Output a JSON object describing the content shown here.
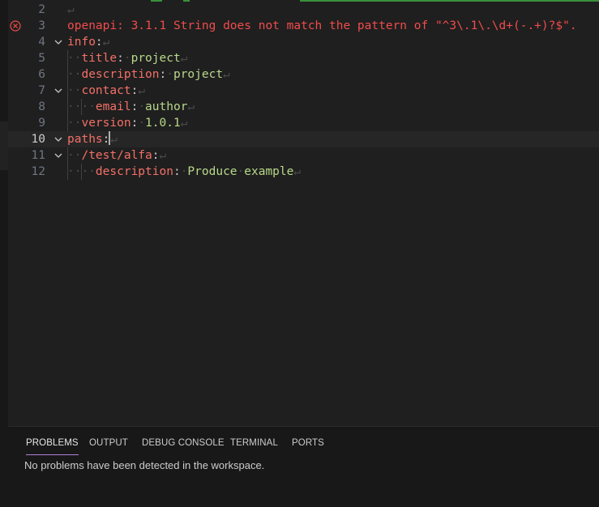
{
  "editor": {
    "lines": [
      {
        "number": "2",
        "segments": []
      },
      {
        "number": "3",
        "error": true,
        "segments": [
          {
            "t": "openapi",
            "c": "err"
          },
          {
            "t": ":",
            "c": "err"
          },
          {
            "t": " ",
            "c": "err"
          },
          {
            "t": "3.1.1 String does not match the pattern of \"^3\\.1\\.\\d+(-.+)?$\".",
            "c": "err"
          }
        ]
      },
      {
        "number": "4",
        "fold": true,
        "segments": [
          {
            "t": "info",
            "c": "k"
          },
          {
            "t": ":",
            "c": "pun"
          }
        ]
      },
      {
        "number": "5",
        "segments": [
          {
            "t": "··",
            "c": "ws"
          },
          {
            "t": "title",
            "c": "k"
          },
          {
            "t": ":",
            "c": "pun"
          },
          {
            "t": "·",
            "c": "ws"
          },
          {
            "t": "project",
            "c": "str"
          }
        ]
      },
      {
        "number": "6",
        "segments": [
          {
            "t": "··",
            "c": "ws"
          },
          {
            "t": "description",
            "c": "k"
          },
          {
            "t": ":",
            "c": "pun"
          },
          {
            "t": "·",
            "c": "ws"
          },
          {
            "t": "project",
            "c": "str"
          }
        ]
      },
      {
        "number": "7",
        "fold": true,
        "segments": [
          {
            "t": "··",
            "c": "ws"
          },
          {
            "t": "contact",
            "c": "k"
          },
          {
            "t": ":",
            "c": "pun"
          }
        ]
      },
      {
        "number": "8",
        "segments": [
          {
            "t": "····",
            "c": "ws"
          },
          {
            "t": "email",
            "c": "k"
          },
          {
            "t": ":",
            "c": "pun"
          },
          {
            "t": "·",
            "c": "ws"
          },
          {
            "t": "author",
            "c": "str"
          }
        ]
      },
      {
        "number": "9",
        "segments": [
          {
            "t": "··",
            "c": "ws"
          },
          {
            "t": "version",
            "c": "k"
          },
          {
            "t": ":",
            "c": "pun"
          },
          {
            "t": "·",
            "c": "ws"
          },
          {
            "t": "1.0.1",
            "c": "str"
          }
        ]
      },
      {
        "number": "10",
        "fold": true,
        "current": true,
        "segments": [
          {
            "t": "paths",
            "c": "k"
          },
          {
            "t": ":",
            "c": "pun",
            "cursor": true
          }
        ]
      },
      {
        "number": "11",
        "fold": true,
        "segments": [
          {
            "t": "··",
            "c": "ws"
          },
          {
            "t": "/test/alfa",
            "c": "k"
          },
          {
            "t": ":",
            "c": "pun"
          }
        ]
      },
      {
        "number": "12",
        "segments": [
          {
            "t": "····",
            "c": "ws"
          },
          {
            "t": "description",
            "c": "k"
          },
          {
            "t": ":",
            "c": "pun"
          },
          {
            "t": "·",
            "c": "ws"
          },
          {
            "t": "Produce",
            "c": "str"
          },
          {
            "t": "·",
            "c": "ws"
          },
          {
            "t": "example",
            "c": "str"
          }
        ]
      }
    ],
    "newline_glyph": "↵"
  },
  "panel": {
    "tabs": [
      {
        "label": "PROBLEMS",
        "active": true
      },
      {
        "label": "OUTPUT"
      },
      {
        "label": "DEBUG CONSOLE"
      },
      {
        "label": "TERMINAL"
      },
      {
        "label": "PORTS"
      }
    ],
    "message": "No problems have been detected in the workspace."
  },
  "colors": {
    "error": "#f14c4c",
    "key": "#f47067",
    "string": "#b8d98a",
    "active_tab_underline": "#b180d7"
  }
}
